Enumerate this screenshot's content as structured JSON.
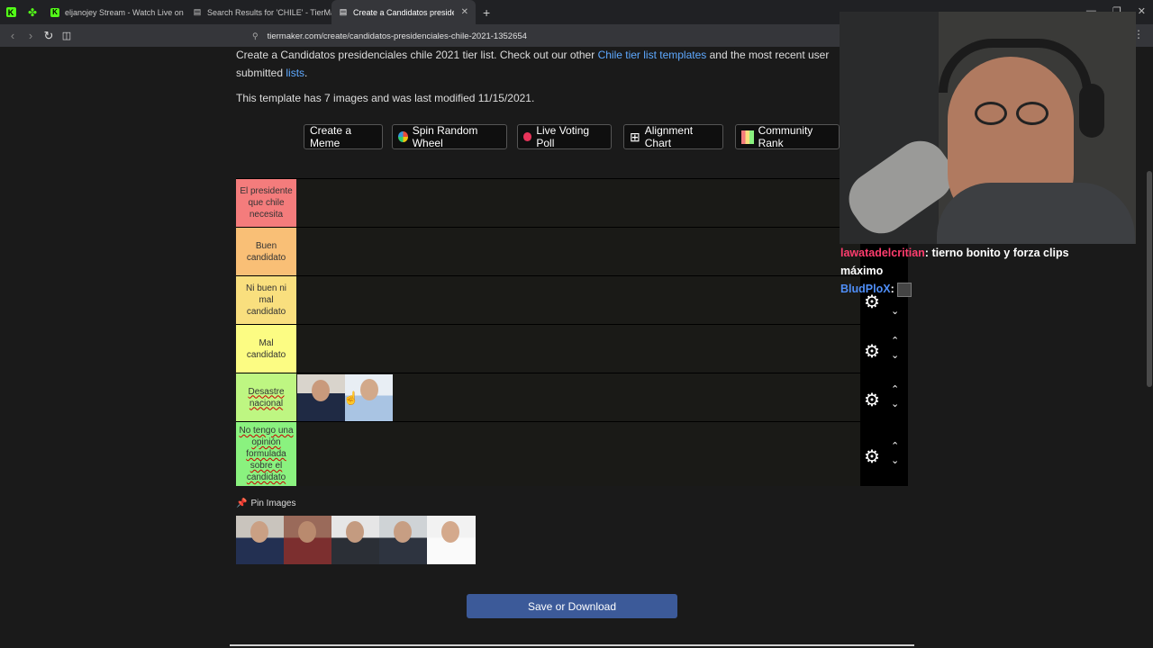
{
  "browser": {
    "tabs": [
      {
        "label": "eljanojey Stream - Watch Live on Kick",
        "icon": "kick-icon"
      },
      {
        "label": "Search Results for 'CHILE' - TierMaker",
        "icon": "tiermaker-icon"
      },
      {
        "label": "Create a Candidatos presidencia",
        "icon": "tiermaker-icon",
        "active": true
      }
    ],
    "url": "tiermaker.com/create/candidatos-presidenciales-chile-2021-1352654",
    "new_tab": "+"
  },
  "page": {
    "intro_start": "Create a Candidatos presidenciales chile 2021 tier list. Check out our other ",
    "intro_link1": "Chile tier list templates",
    "intro_mid": " and the most recent user submitted ",
    "intro_link2": "lists",
    "intro_end": ".",
    "modified": "This template has 7 images and was last modified 11/15/2021.",
    "buttons": [
      {
        "label": "Create a Meme",
        "icon": ""
      },
      {
        "label": "Spin Random Wheel",
        "icon": "wheel-icon"
      },
      {
        "label": "Live Voting Poll",
        "icon": "record-icon"
      },
      {
        "label": "Alignment Chart",
        "icon": "grid-icon"
      },
      {
        "label": "Community Rank",
        "icon": "color-grid-icon"
      }
    ],
    "tiers": [
      {
        "label": "El presidente que chile necesita",
        "color": "#f47c7c"
      },
      {
        "label": "Buen candidato",
        "color": "#f9bf76"
      },
      {
        "label": "Ni buen ni mal candidato",
        "color": "#f9df7e"
      },
      {
        "label": "Mal candidato",
        "color": "#fcfc83"
      },
      {
        "label": "Desastre nacional",
        "color": "#bef682"
      },
      {
        "label": "No tengo una opinión formulada sobre el candidato",
        "color": "#8af27f"
      }
    ],
    "pin_label": "Pin Images",
    "save_label": "Save or Download"
  },
  "chat": {
    "messages": [
      {
        "user": "lawatadelcritian",
        "sep": ": ",
        "text": "tierno bonito y forza clips máximo"
      },
      {
        "user": "BludPloX",
        "sep": ": ",
        "text": ""
      }
    ]
  }
}
